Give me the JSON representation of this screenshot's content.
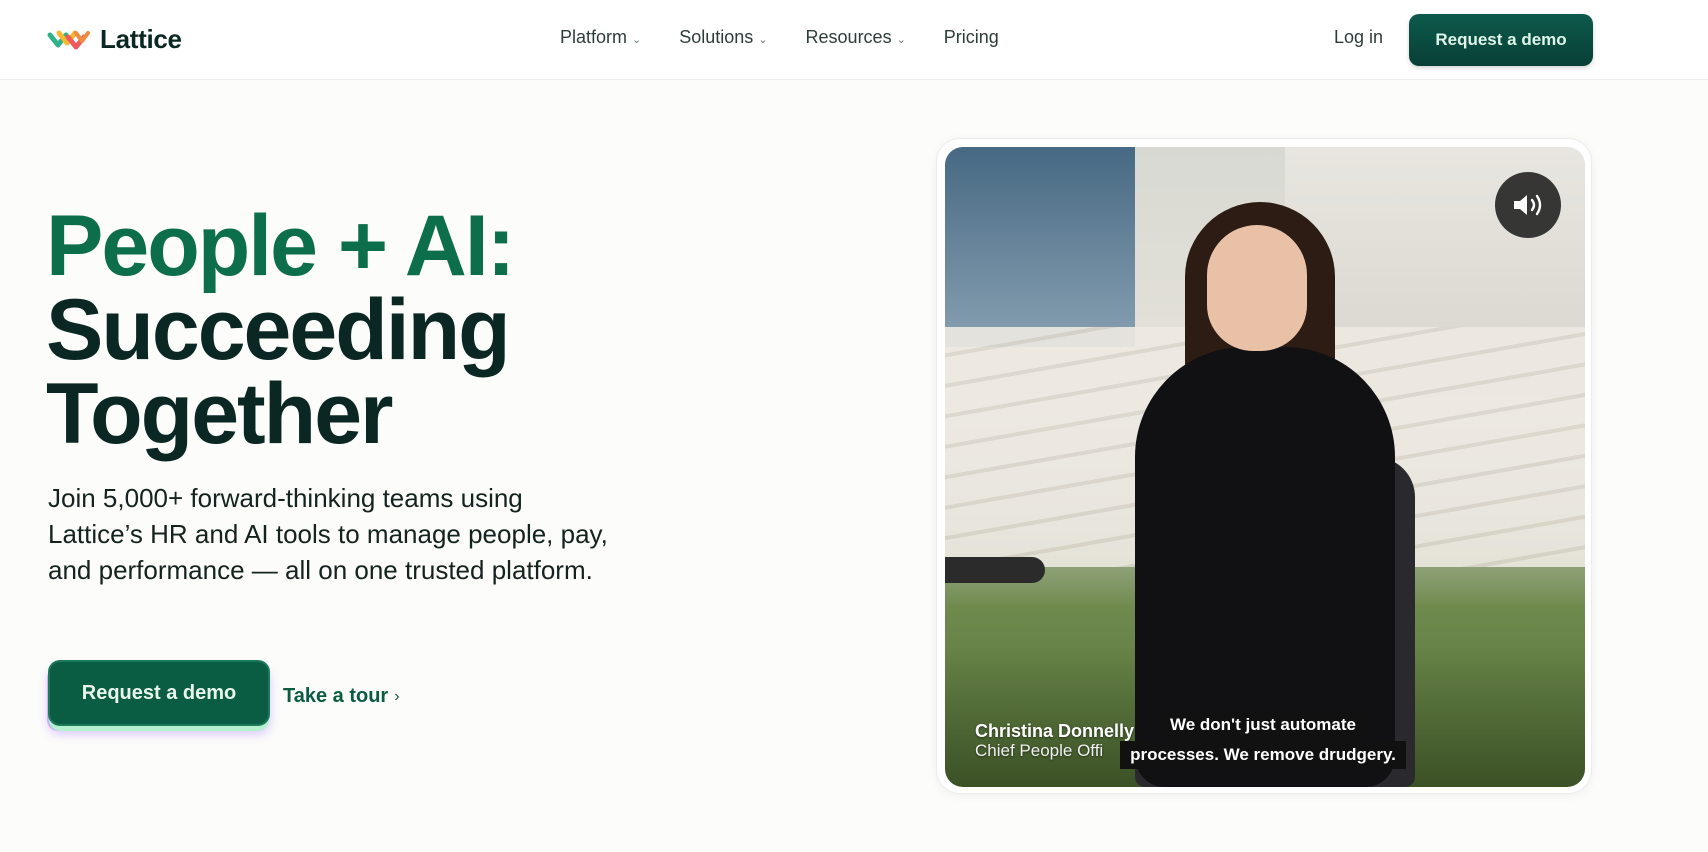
{
  "header": {
    "brand": "Lattice",
    "nav": [
      {
        "label": "Platform",
        "has_dropdown": true
      },
      {
        "label": "Solutions",
        "has_dropdown": true
      },
      {
        "label": "Resources",
        "has_dropdown": true
      },
      {
        "label": "Pricing",
        "has_dropdown": false
      }
    ],
    "login_label": "Log in",
    "cta_label": "Request a demo"
  },
  "hero": {
    "headline_part1": "People + AI:",
    "headline_part2": "Succeeding",
    "headline_part3": "Together",
    "subtext": "Join 5,000+ forward-thinking teams using Lattice’s HR and AI tools to manage people, pay, and performance — all on one trusted platform.",
    "cta_label": "Request a demo",
    "tour_label": "Take a tour",
    "tour_arrow": "›"
  },
  "video": {
    "speaker_name": "Christina Donnelly",
    "speaker_title": "Chief People Offi",
    "caption_line1": "We don't just automate",
    "caption_line2": "processes. We remove drudgery.",
    "mute_icon": "speaker-volume-icon"
  },
  "colors": {
    "accent_green": "#0d6e4c",
    "cta_dark": "#083f36",
    "text_dark": "#0b2723"
  }
}
